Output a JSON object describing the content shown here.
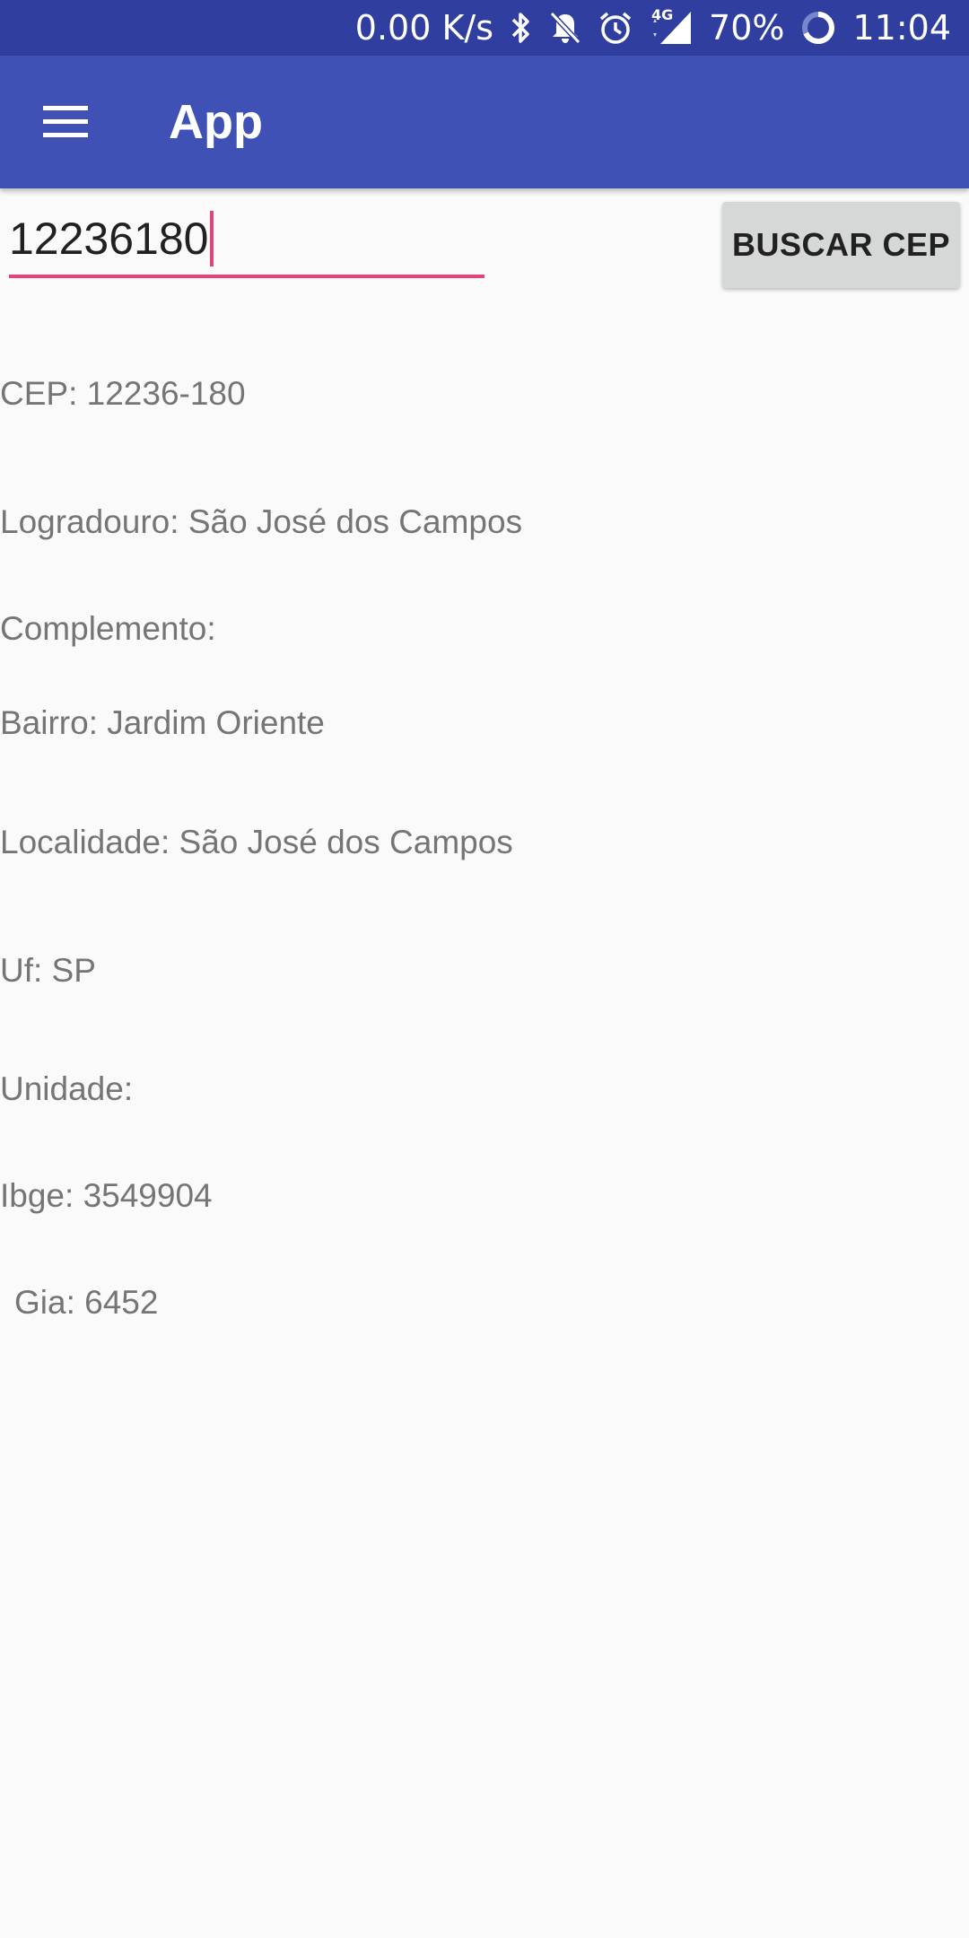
{
  "status_bar": {
    "net_speed": "0.00 K/s",
    "network_type": "4G",
    "battery": "70%",
    "time": "11:04",
    "icons": [
      "bluetooth-icon",
      "notifications-off-icon",
      "alarm-icon",
      "signal-icon",
      "battery-icon"
    ]
  },
  "app_bar": {
    "title": "App",
    "menu_icon": "menu-icon"
  },
  "search": {
    "value": "12236180",
    "button_label": "BUSCAR CEP"
  },
  "results": {
    "cep": "CEP: 12236-180",
    "logradouro": "Logradouro: São José dos Campos",
    "complemento": "Complemento:",
    "bairro": "Bairro: Jardim Oriente",
    "localidade": "Localidade: São José dos Campos",
    "uf": "Uf: SP",
    "unidade": "Unidade:",
    "ibge": "Ibge: 3549904",
    "gia": "Gia: 6452"
  },
  "colors": {
    "status_bar": "#303f9f",
    "app_bar": "#3f51b5",
    "accent": "#e2457a",
    "button": "#d6d7d7",
    "text_secondary": "#757575"
  }
}
